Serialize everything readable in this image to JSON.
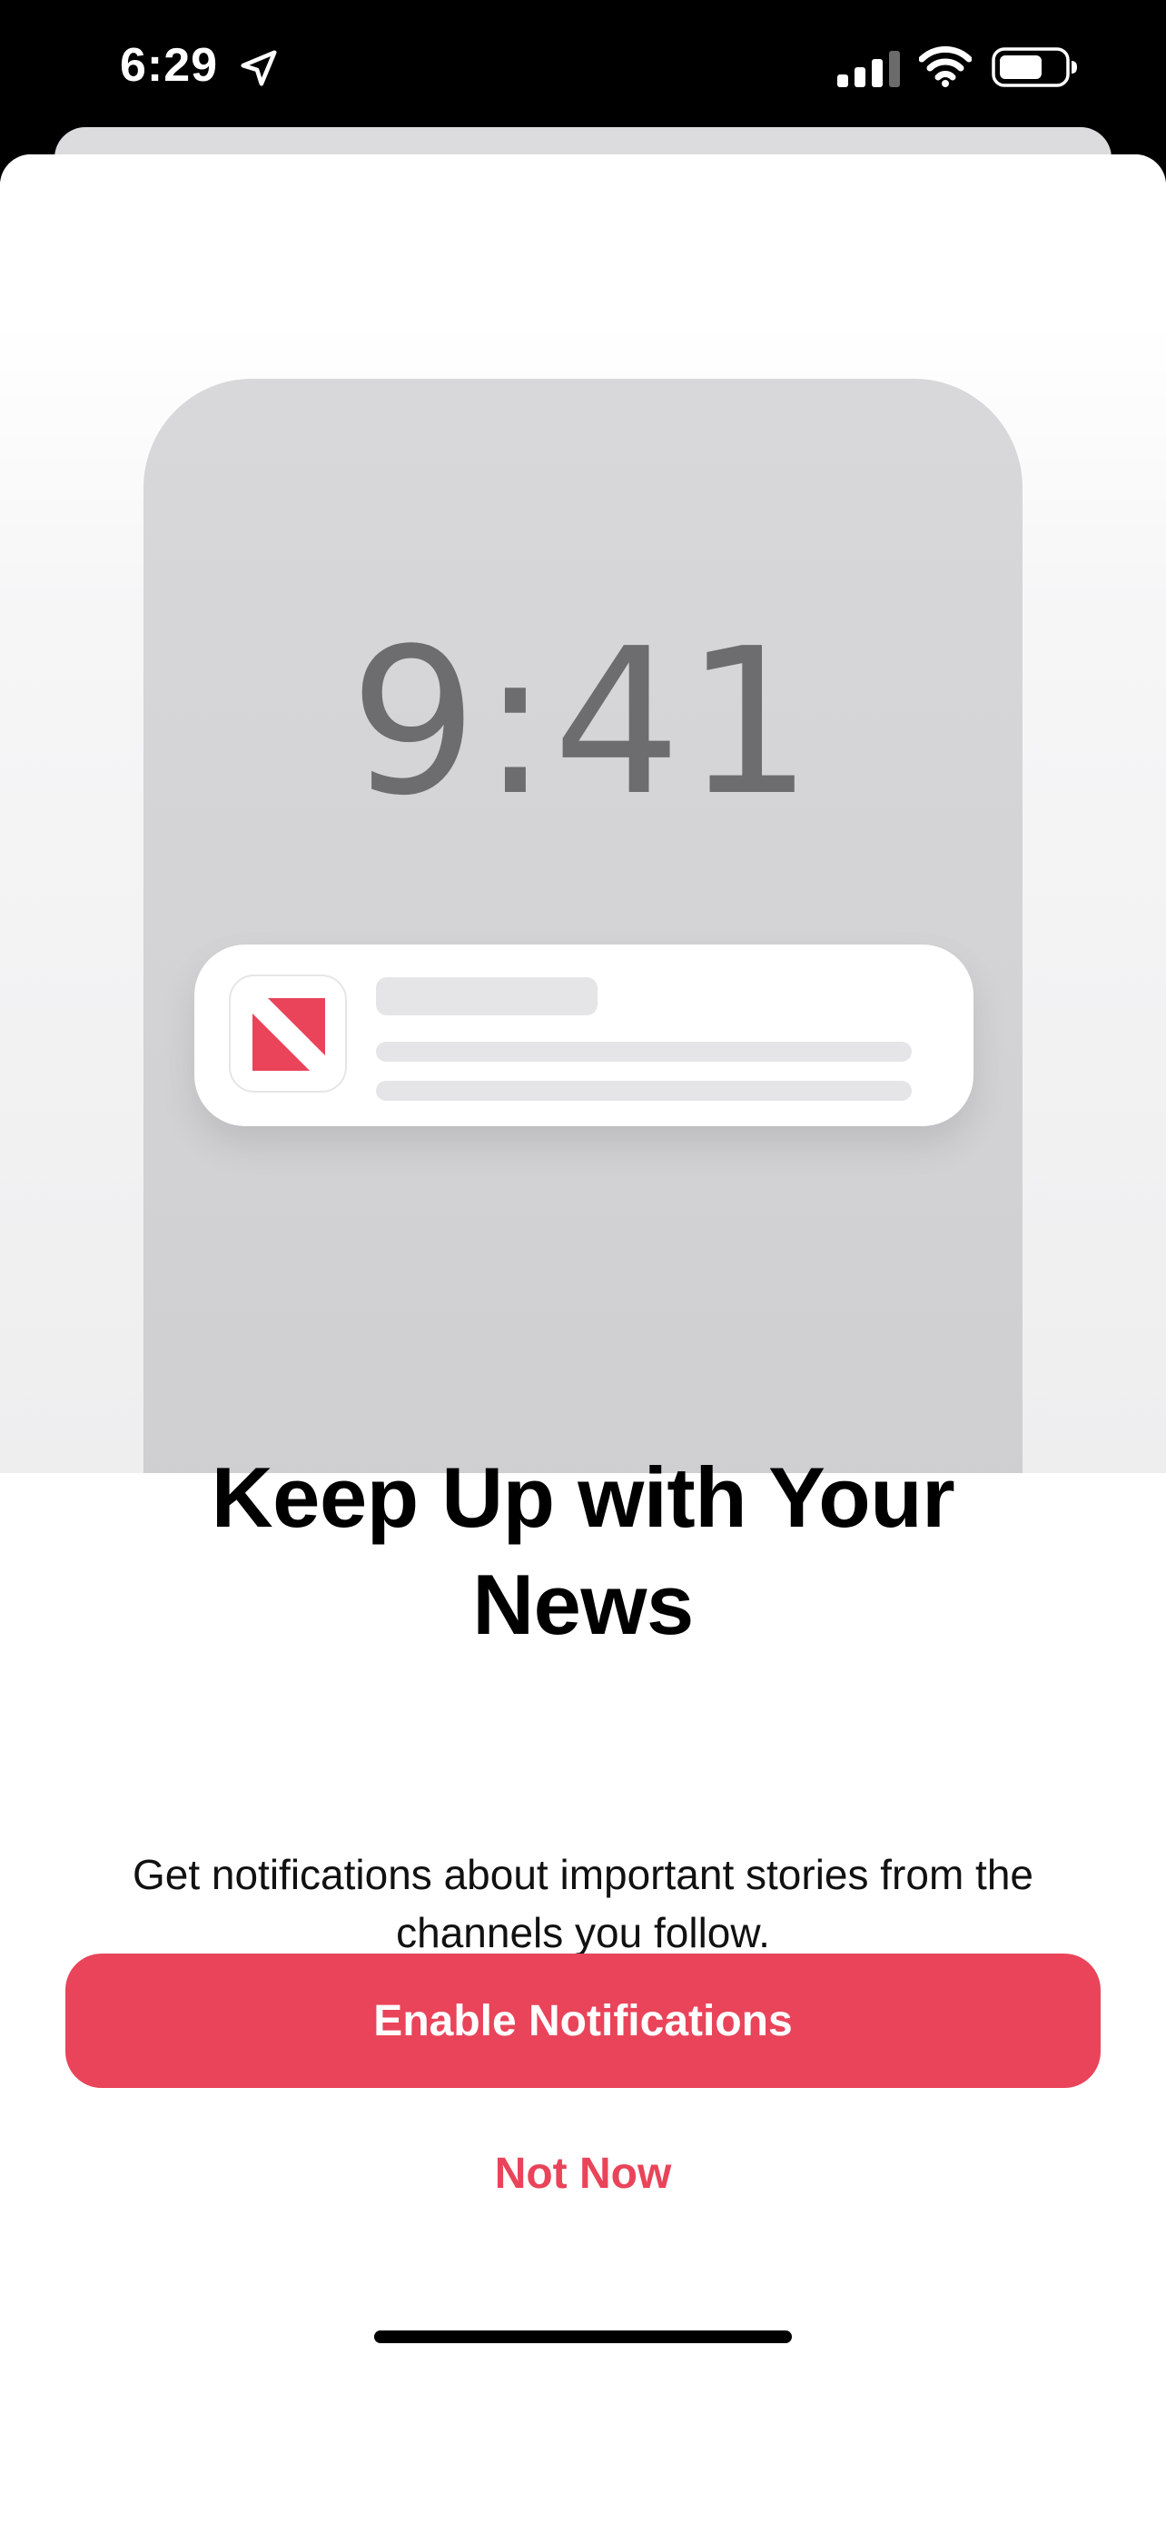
{
  "status_bar": {
    "time": "6:29",
    "icons": [
      "location-arrow-icon",
      "cellular-signal-icon",
      "wifi-icon",
      "battery-icon"
    ]
  },
  "illustration": {
    "lock_screen_time": "9:41",
    "app_icon": "apple-news-icon"
  },
  "prompt": {
    "title": "Keep Up with Your News",
    "message": "Get notifications about important stories from the channels you follow."
  },
  "actions": {
    "primary_label": "Enable Notifications",
    "secondary_label": "Not Now"
  },
  "colors": {
    "accent": "#e9445a",
    "background": "#ffffff",
    "status_bar": "#000000"
  }
}
